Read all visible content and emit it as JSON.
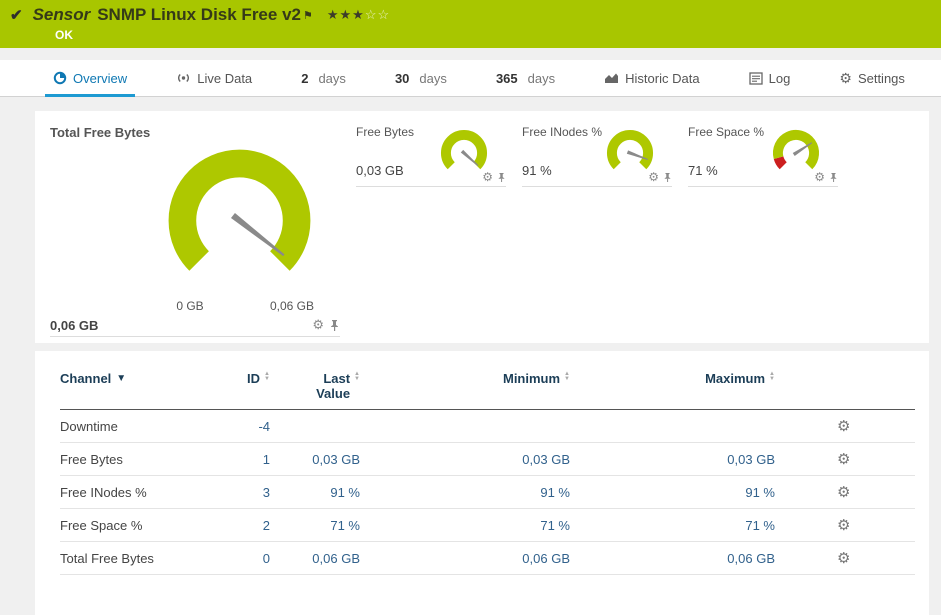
{
  "header": {
    "kind": "Sensor",
    "title": "SNMP Linux Disk Free v2",
    "status": "OK",
    "rating_filled": "★★★",
    "rating_empty": "☆☆"
  },
  "tabs": [
    {
      "label": "Overview"
    },
    {
      "label": "Live Data"
    },
    {
      "num": "2",
      "label": "days"
    },
    {
      "num": "30",
      "label": "days"
    },
    {
      "num": "365",
      "label": "days"
    },
    {
      "label": "Historic Data"
    },
    {
      "label": "Log"
    },
    {
      "label": "Settings"
    }
  ],
  "gauges": {
    "main": {
      "title": "Total Free Bytes",
      "min": "0 GB",
      "max": "0,06 GB",
      "value": "0,06 GB"
    },
    "small": [
      {
        "title": "Free Bytes",
        "value": "0,03 GB"
      },
      {
        "title": "Free INodes %",
        "value": "91 %"
      },
      {
        "title": "Free Space %",
        "value": "71 %"
      }
    ]
  },
  "table": {
    "headers": {
      "channel": "Channel",
      "id": "ID",
      "last": "Last Value",
      "min": "Minimum",
      "max": "Maximum"
    },
    "rows": [
      {
        "channel": "Downtime",
        "id": "-4",
        "last": "",
        "min": "",
        "max": ""
      },
      {
        "channel": "Free Bytes",
        "id": "1",
        "last": "0,03 GB",
        "min": "0,03 GB",
        "max": "0,03 GB"
      },
      {
        "channel": "Free INodes %",
        "id": "3",
        "last": "91 %",
        "min": "91 %",
        "max": "91 %"
      },
      {
        "channel": "Free Space %",
        "id": "2",
        "last": "71 %",
        "min": "71 %",
        "max": "71 %"
      },
      {
        "channel": "Total Free Bytes",
        "id": "0",
        "last": "0,06 GB",
        "min": "0,06 GB",
        "max": "0,06 GB"
      }
    ]
  },
  "colors": {
    "brand_green": "#a8c600",
    "gauge_green": "#aec800",
    "accent_blue": "#0f78b3",
    "tab_underline": "#1e9ad2",
    "status_red": "#cc1f1f",
    "needle": "#8a8a8a"
  }
}
